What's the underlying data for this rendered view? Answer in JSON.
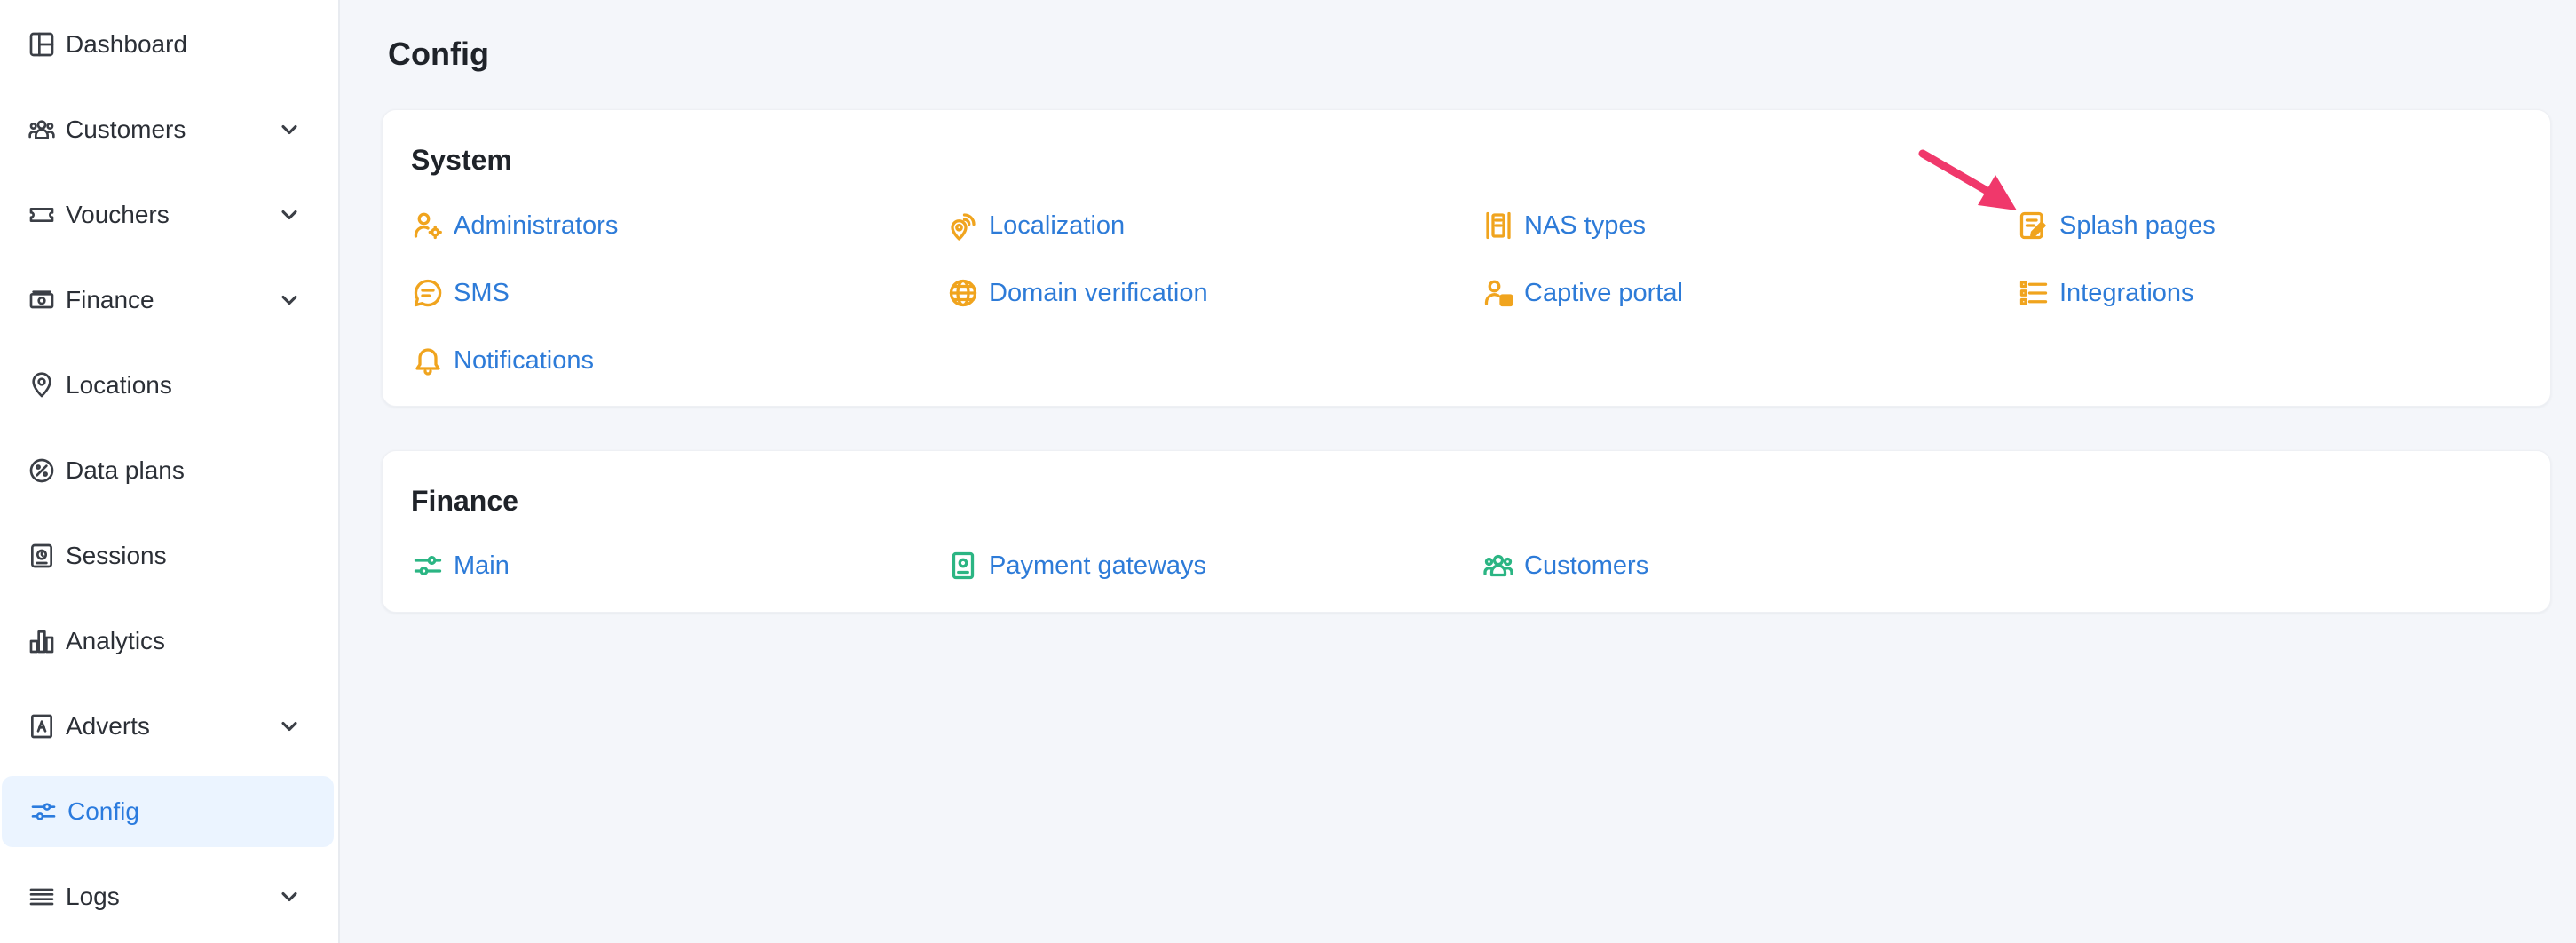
{
  "sidebar": {
    "items": [
      {
        "label": "Dashboard",
        "icon": "dashboard-icon",
        "expandable": false,
        "active": false
      },
      {
        "label": "Customers",
        "icon": "customers-icon",
        "expandable": true,
        "active": false
      },
      {
        "label": "Vouchers",
        "icon": "voucher-icon",
        "expandable": true,
        "active": false
      },
      {
        "label": "Finance",
        "icon": "finance-icon",
        "expandable": true,
        "active": false
      },
      {
        "label": "Locations",
        "icon": "location-pin-icon",
        "expandable": false,
        "active": false
      },
      {
        "label": "Data plans",
        "icon": "data-plans-icon",
        "expandable": false,
        "active": false
      },
      {
        "label": "Sessions",
        "icon": "sessions-icon",
        "expandable": false,
        "active": false
      },
      {
        "label": "Analytics",
        "icon": "analytics-icon",
        "expandable": false,
        "active": false
      },
      {
        "label": "Adverts",
        "icon": "adverts-icon",
        "expandable": true,
        "active": false
      },
      {
        "label": "Config",
        "icon": "sliders-icon",
        "expandable": false,
        "active": true
      },
      {
        "label": "Logs",
        "icon": "logs-icon",
        "expandable": true,
        "active": false
      }
    ]
  },
  "page": {
    "title": "Config"
  },
  "system": {
    "title": "System",
    "links": [
      {
        "label": "Administrators",
        "icon": "admin-icon"
      },
      {
        "label": "Localization",
        "icon": "localization-icon"
      },
      {
        "label": "NAS types",
        "icon": "nas-types-icon"
      },
      {
        "label": "Splash pages",
        "icon": "splash-pages-icon"
      },
      {
        "label": "SMS",
        "icon": "sms-icon"
      },
      {
        "label": "Domain verification",
        "icon": "globe-icon"
      },
      {
        "label": "Captive portal",
        "icon": "captive-portal-icon"
      },
      {
        "label": "Integrations",
        "icon": "integrations-icon"
      },
      {
        "label": "Notifications",
        "icon": "bell-icon"
      }
    ]
  },
  "finance": {
    "title": "Finance",
    "links": [
      {
        "label": "Main",
        "icon": "sliders-icon"
      },
      {
        "label": "Payment gateways",
        "icon": "payment-gateways-icon"
      },
      {
        "label": "Customers",
        "icon": "customers-icon"
      }
    ]
  },
  "colors": {
    "accent": "#2d7bd8",
    "system_icon": "#f0a41e",
    "finance_icon": "#2bb583",
    "arrow": "#f0386b",
    "active_bg": "#ebf4ff"
  }
}
